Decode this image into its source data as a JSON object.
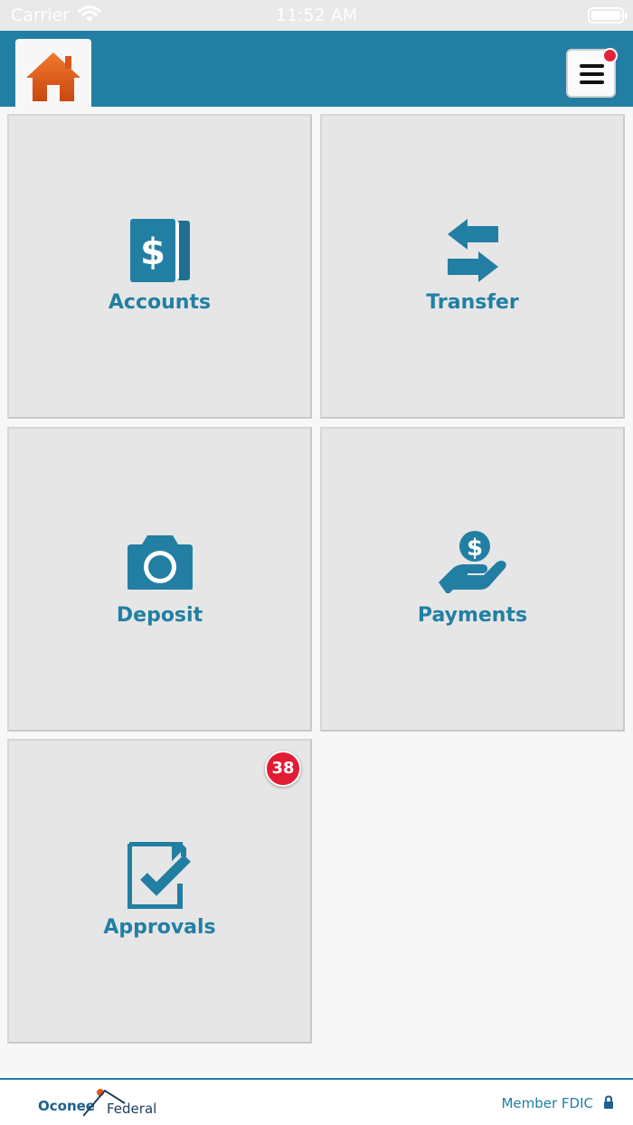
{
  "status_bar": {
    "carrier": "Carrier",
    "time": "11:52 AM"
  },
  "nav": {
    "home_icon": "home-icon",
    "menu_icon": "hamburger-menu-icon",
    "has_notification": true
  },
  "tiles": [
    {
      "label": "Accounts",
      "icon": "dollar-cards-icon"
    },
    {
      "label": "Transfer",
      "icon": "transfer-arrows-icon"
    },
    {
      "label": "Deposit",
      "icon": "camera-icon"
    },
    {
      "label": "Payments",
      "icon": "hand-coin-icon"
    },
    {
      "label": "Approvals",
      "icon": "checkbox-icon",
      "badge": "38"
    }
  ],
  "footer": {
    "logo_text_1": "Oconee",
    "logo_text_2": "Federal",
    "fdic": "Member FDIC"
  },
  "colors": {
    "brand": "#227fa3",
    "home_orange": "#e0571b",
    "badge_red": "#e21c34",
    "tile_bg": "#e6e6e6"
  }
}
